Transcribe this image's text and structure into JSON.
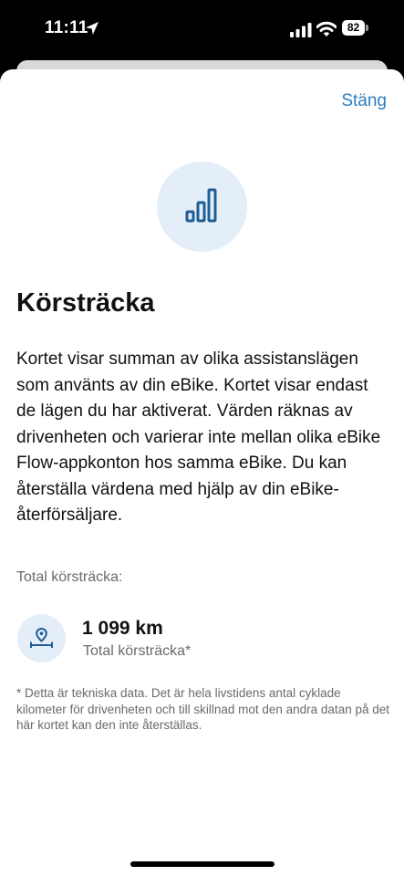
{
  "status_bar": {
    "time": "11:11",
    "battery": "82",
    "icons": [
      "location-arrow-icon",
      "cellular-signal-icon",
      "wifi-icon",
      "battery-icon"
    ]
  },
  "sheet": {
    "close_label": "Stäng",
    "hero_icon": "bar-chart-icon",
    "title": "Körsträcka",
    "description": "Kortet visar summan av olika assistanslägen som använts av din eBike. Kortet visar endast de lägen du har aktiverat. Värden räknas av drivenheten och varierar inte mellan olika eBike Flow-appkonton hos samma eBike. Du kan återställa värdena med hjälp av din eBike-återförsäljare.",
    "section_label": "Total körsträcka:",
    "stat": {
      "icon": "distance-pin-icon",
      "value": "1 099 km",
      "label": "Total körsträcka*"
    },
    "footnote": "* Detta är tekniska data. Det är hela livstidens antal cyklade kilometer för drivenheten och till skillnad mot den andra datan på det här kortet kan den inte återställas."
  },
  "colors": {
    "accent": "#2a7ec2",
    "icon_bg": "#e4eef8",
    "icon_stroke": "#1f5d94",
    "secondary_text": "#6a6a6a"
  }
}
